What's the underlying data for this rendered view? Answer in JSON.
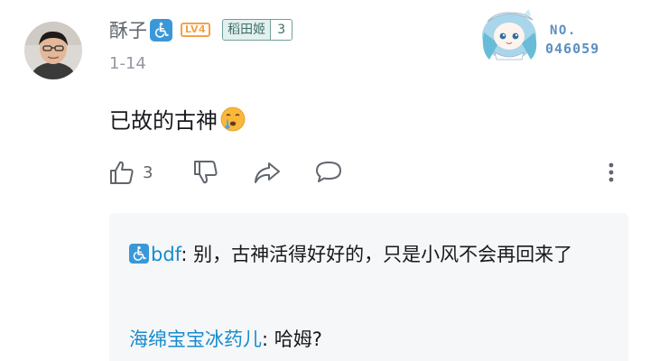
{
  "comment": {
    "user": {
      "name": "酥子",
      "level": "LV4",
      "accessibility_badge": "wheelchair-icon"
    },
    "medal": {
      "name": "稻田姬",
      "level": "3"
    },
    "date": "1-14",
    "text": "已故的古神",
    "emoji": "crying-face-emoji",
    "fan_card": {
      "label": "NO.",
      "number": "046059"
    },
    "actions": {
      "like_count": "3",
      "like_icon": "thumb-up-icon",
      "dislike_icon": "thumb-down-icon",
      "share_icon": "share-icon",
      "reply_icon": "chat-bubble-icon",
      "more_icon": "more-vertical-icon"
    }
  },
  "replies": [
    {
      "user": "bdf",
      "separator": ": ",
      "text": "别，古神活得好好的，只是小风不会再回来了",
      "has_badge": true
    },
    {
      "user": "海绵宝宝冰药儿",
      "separator": ": ",
      "text": "哈姆?",
      "has_badge": false
    }
  ],
  "colors": {
    "username": "#61666d",
    "reply_username": "#178bcf",
    "badge_blue": "#3a98d8",
    "level_orange": "#f4a246",
    "medal_green": "#6fa09a",
    "muted": "#9499a0"
  }
}
